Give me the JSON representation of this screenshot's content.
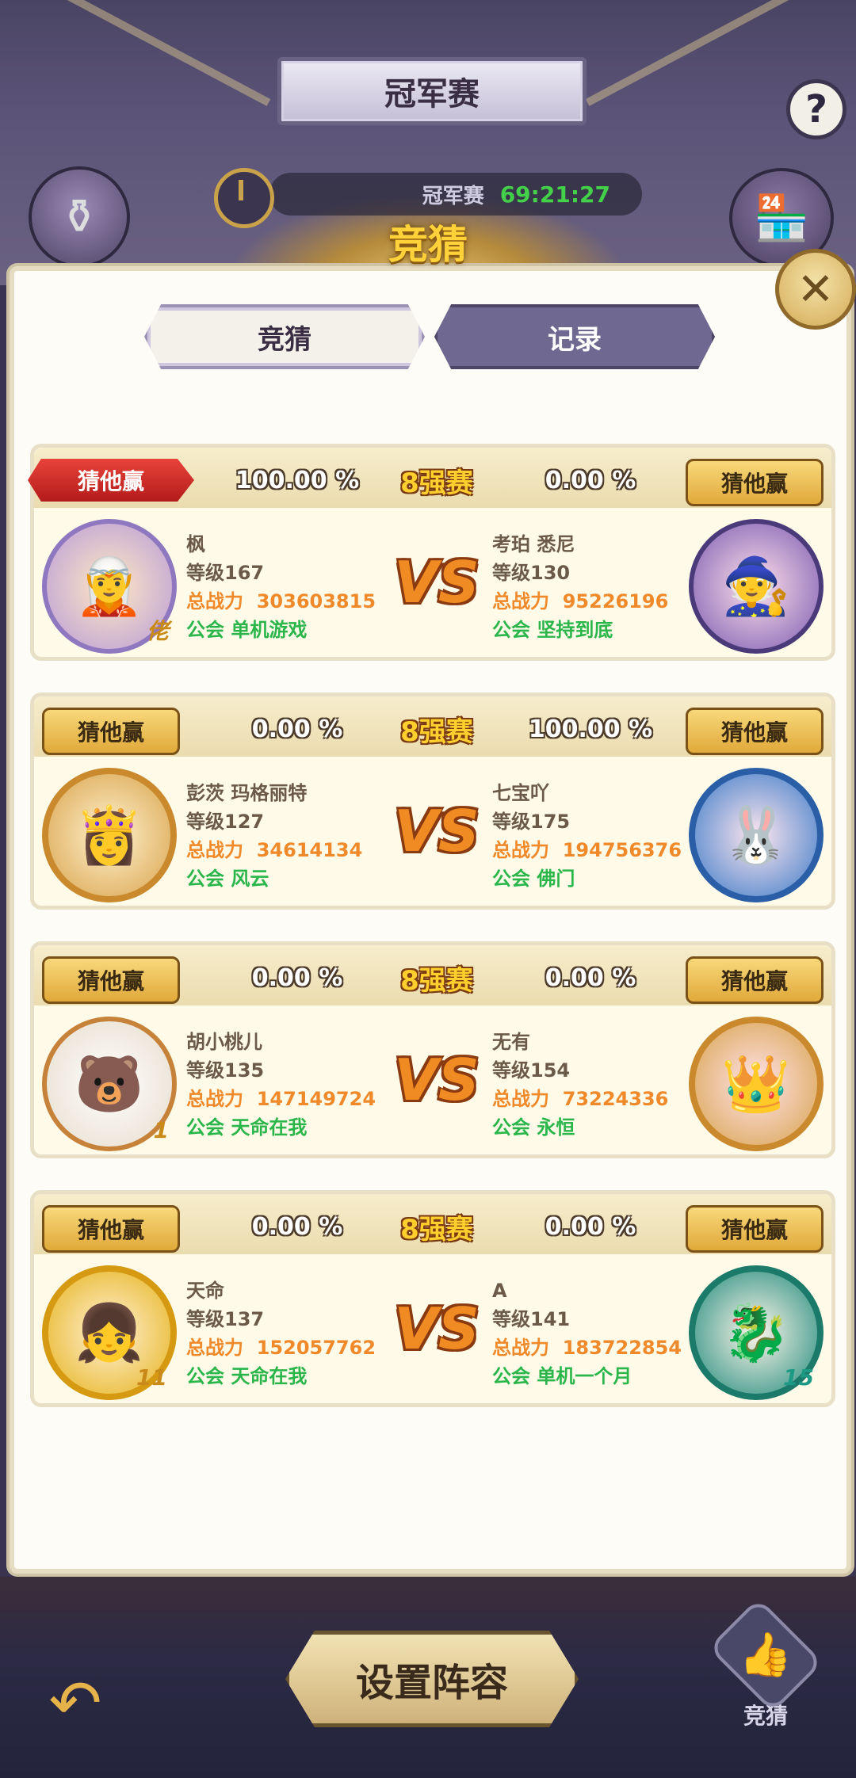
{
  "header": {
    "title": "冠军赛",
    "help_label": "?",
    "timer_label": "冠军赛",
    "timer_value": "69:21:27"
  },
  "dialog": {
    "title": "竞猜",
    "close_label": "✕",
    "tabs": [
      {
        "label": "竞猜",
        "active": true
      },
      {
        "label": "记录",
        "active": false
      }
    ]
  },
  "matches": [
    {
      "left_btn": "猜他赢",
      "left_pct": "100.00 %",
      "stage": "8强赛",
      "right_pct": "0.00 %",
      "right_btn": "猜他赢",
      "left_selected": true,
      "left": {
        "name": "枫",
        "level": "等级167",
        "power_label": "总战力",
        "power": "303603815",
        "guild_label": "公会",
        "guild": "单机游戏",
        "badge": "佬"
      },
      "vs": "VS",
      "right": {
        "name": "考珀 悉尼",
        "level": "等级130",
        "power_label": "总战力",
        "power": "95226196",
        "guild_label": "公会",
        "guild": "坚持到底",
        "badge": ""
      }
    },
    {
      "left_btn": "猜他赢",
      "left_pct": "0.00 %",
      "stage": "8强赛",
      "right_pct": "100.00 %",
      "right_btn": "猜他赢",
      "left_selected": false,
      "left": {
        "name": "彭茨 玛格丽特",
        "level": "等级127",
        "power_label": "总战力",
        "power": "34614134",
        "guild_label": "公会",
        "guild": "风云",
        "badge": ""
      },
      "vs": "VS",
      "right": {
        "name": "七宝吖",
        "level": "等级175",
        "power_label": "总战力",
        "power": "194756376",
        "guild_label": "公会",
        "guild": "佛门",
        "badge": ""
      }
    },
    {
      "left_btn": "猜他赢",
      "left_pct": "0.00 %",
      "stage": "8强赛",
      "right_pct": "0.00 %",
      "right_btn": "猜他赢",
      "left_selected": false,
      "left": {
        "name": "胡小桃儿",
        "level": "等级135",
        "power_label": "总战力",
        "power": "147149724",
        "guild_label": "公会",
        "guild": "天命在我",
        "badge": "1"
      },
      "vs": "VS",
      "right": {
        "name": "无有",
        "level": "等级154",
        "power_label": "总战力",
        "power": "73224336",
        "guild_label": "公会",
        "guild": "永恒",
        "badge": ""
      }
    },
    {
      "left_btn": "猜他赢",
      "left_pct": "0.00 %",
      "stage": "8强赛",
      "right_pct": "0.00 %",
      "right_btn": "猜他赢",
      "left_selected": false,
      "left": {
        "name": "天命",
        "level": "等级137",
        "power_label": "总战力",
        "power": "152057762",
        "guild_label": "公会",
        "guild": "天命在我",
        "badge": "11"
      },
      "vs": "VS",
      "right": {
        "name": "A",
        "level": "等级141",
        "power_label": "总战力",
        "power": "183722854",
        "guild_label": "公会",
        "guild": "单机一个月",
        "badge": "15"
      }
    }
  ],
  "footer": {
    "setup_label": "设置阵容",
    "guess_label": "竞猜",
    "back_icon": "back-arrow-icon",
    "guess_icon": "thumbs-up-icon"
  },
  "colors": {
    "gold": "#ffd23a",
    "power": "#f0892a",
    "guild": "#2bb64b",
    "selected": "#d42828",
    "timer": "#43d14a"
  }
}
